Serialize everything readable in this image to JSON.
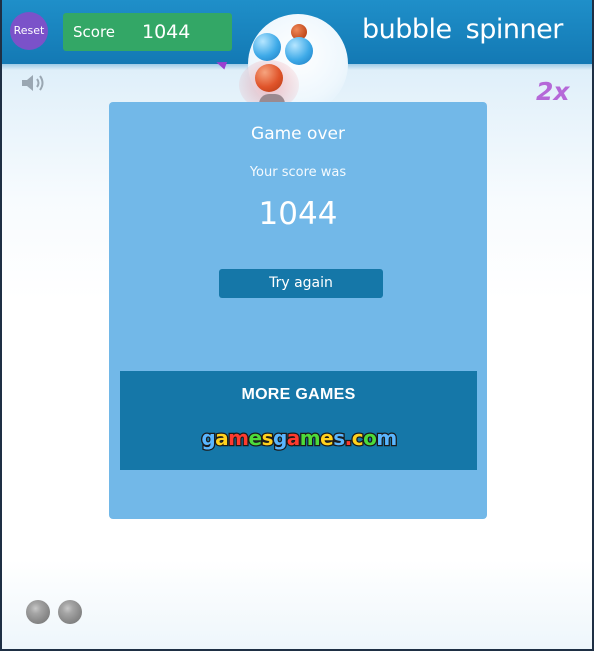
{
  "topbar": {
    "reset_label": "Reset",
    "score_label": "Score",
    "score_value": "1044",
    "logo_word1": "bubble",
    "logo_word2": "spinner"
  },
  "hud": {
    "multiplier": "2x",
    "sound_icon": "speaker-icon"
  },
  "dialog": {
    "title": "Game over",
    "subtitle": "Your score was",
    "score": "1044",
    "try_again_label": "Try again",
    "more_games_label": "MORE GAMES",
    "sponsor_logo_text": "gamesgames.com",
    "sponsor_colors": [
      "#5ab6ff",
      "#ffd21e",
      "#ff3b2f",
      "#4ddb3a",
      "#ffd21e",
      "#5ab6ff",
      "#ff3b2f",
      "#4ddb3a",
      "#ffd21e",
      "#5ab6ff",
      "#ff3b2f",
      "#ffd21e",
      "#4ddb3a",
      "#5ab6ff"
    ]
  },
  "colors": {
    "topbar": "#1f8fc9",
    "reset": "#7b52c9",
    "score_panel": "#33a766",
    "dialog": "#72b8e8",
    "button": "#1577a8",
    "multiplier": "#b568d8"
  }
}
